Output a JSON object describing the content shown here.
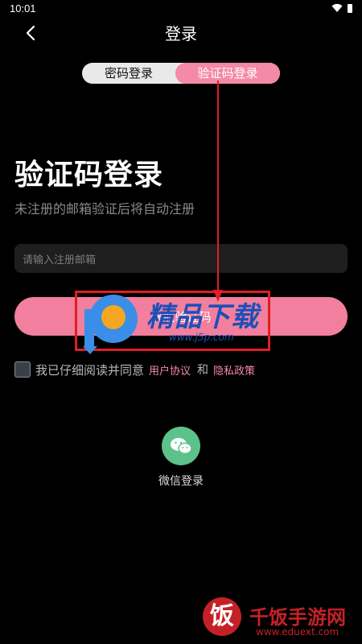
{
  "status_bar": {
    "time": "10:01"
  },
  "header": {
    "title": "登录"
  },
  "tabs": [
    {
      "label": "密码登录",
      "active": false
    },
    {
      "label": "验证码登录",
      "active": true
    }
  ],
  "heading": "验证码登录",
  "subtitle": "未注册的邮箱验证后将自动注册",
  "email": {
    "placeholder": "请输入注册邮箱",
    "value": ""
  },
  "get_code_button": {
    "label": "获取验证码"
  },
  "agreement": {
    "checked": false,
    "text": "我已仔细阅读并同意",
    "user_agreement": "用户协议",
    "and": "和",
    "privacy_policy": "隐私政策"
  },
  "wechat_login": {
    "label": "微信登录"
  },
  "watermark": {
    "text": "精品下载",
    "url": "www.j5p.com",
    "site_name": "千饭手游网",
    "site_url": "www.eduext.com",
    "site_glyph": "饭"
  },
  "colors": {
    "accent": "#f48aa5",
    "button": "#f27f9d",
    "wechat": "#5dc18c",
    "annotation": "#e01e24"
  }
}
